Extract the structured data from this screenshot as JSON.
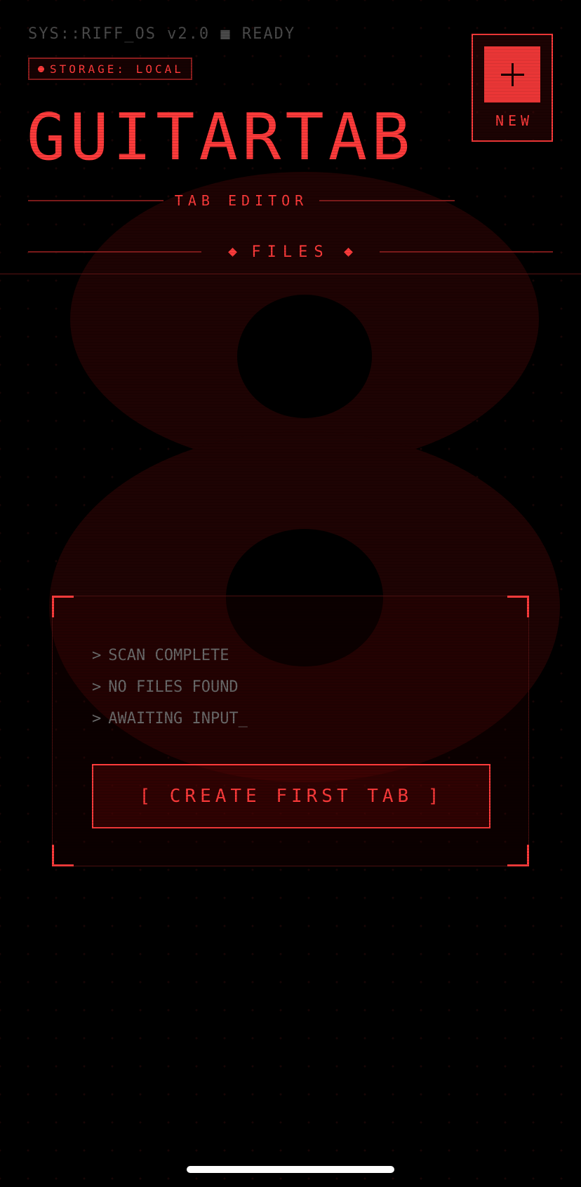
{
  "status_bar": {
    "system_line": "SYS::RIFF_OS v2.0 ■ READY",
    "storage_badge": "STORAGE: LOCAL"
  },
  "header": {
    "title": "GUITARTAB",
    "subtitle": "TAB EDITOR",
    "new_button_label": "NEW"
  },
  "section": {
    "label": "FILES"
  },
  "background": {
    "glyph": "8"
  },
  "empty_state": {
    "lines": [
      {
        "prompt": ">",
        "text": "SCAN COMPLETE"
      },
      {
        "prompt": ">",
        "text": "NO FILES FOUND"
      },
      {
        "prompt": ">",
        "text": "AWAITING INPUT_"
      }
    ],
    "button_label": "[ CREATE FIRST TAB ]"
  },
  "colors": {
    "accent": "#ff3b3b",
    "background": "#000000",
    "muted_text": "#6a6a6a"
  },
  "icons": {
    "new": "plus-icon",
    "storage": "status-dot-icon",
    "section": "diamond-icon"
  }
}
